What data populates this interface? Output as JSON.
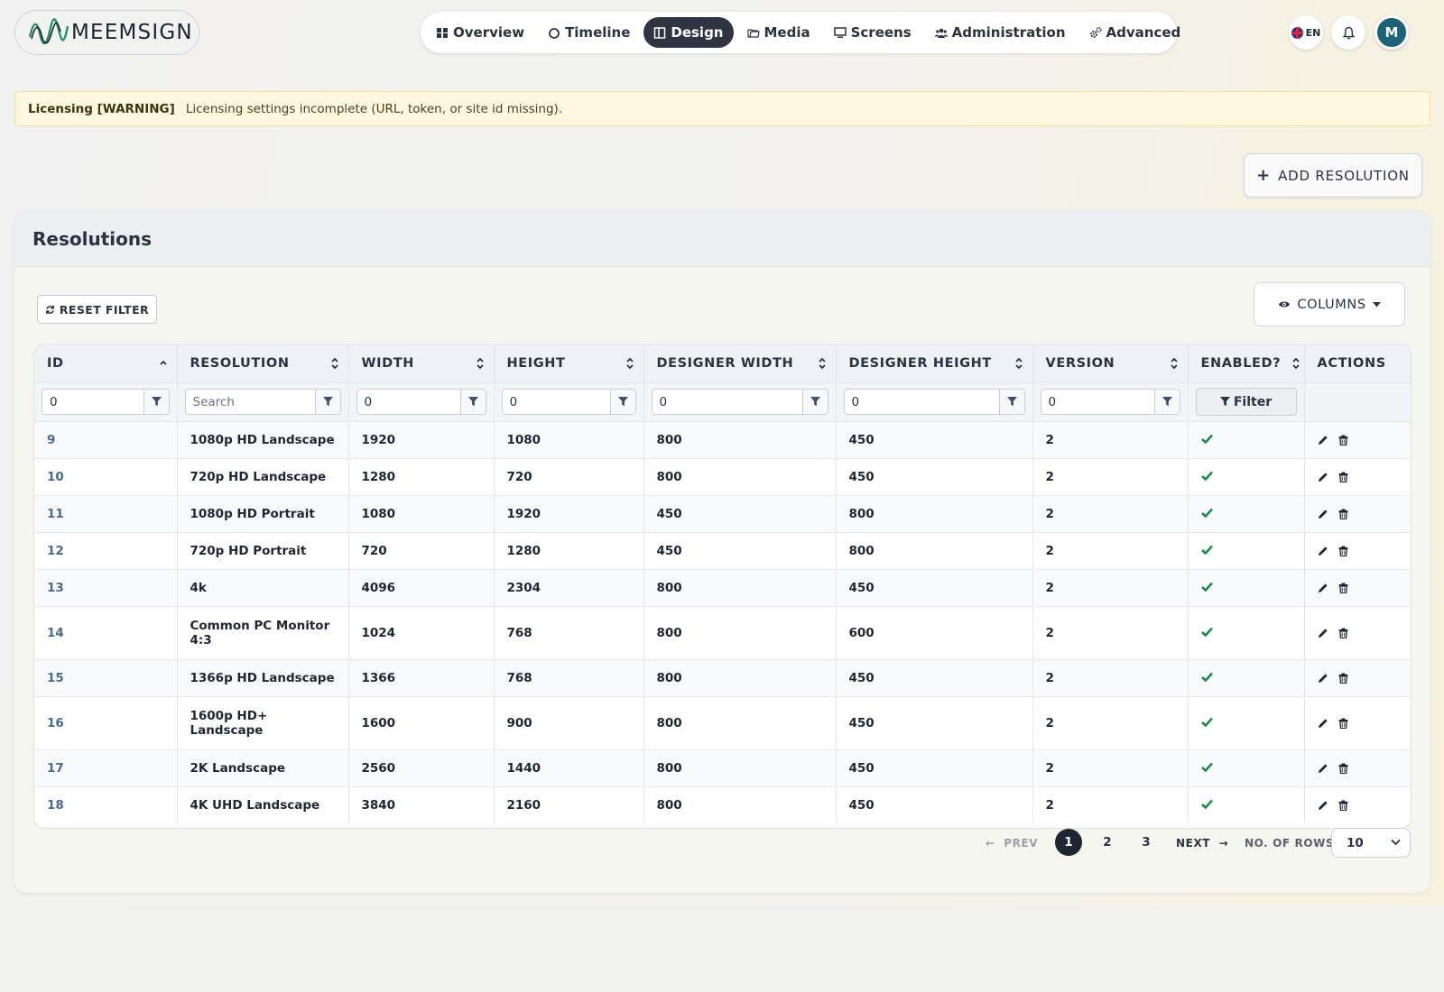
{
  "brand": {
    "name": "MEEMSIGN"
  },
  "nav": {
    "items": [
      {
        "label": "Overview",
        "icon": "grid-icon"
      },
      {
        "label": "Timeline",
        "icon": "circle-icon"
      },
      {
        "label": "Design",
        "icon": "layout-icon",
        "active": true
      },
      {
        "label": "Media",
        "icon": "folder-icon"
      },
      {
        "label": "Screens",
        "icon": "monitor-icon"
      },
      {
        "label": "Administration",
        "icon": "users-icon"
      },
      {
        "label": "Advanced",
        "icon": "cogs-icon"
      }
    ]
  },
  "header": {
    "lang": "EN",
    "avatar_initial": "M"
  },
  "alert": {
    "title": "Licensing [WARNING]",
    "message": "Licensing settings incomplete (URL, token, or site id missing)."
  },
  "toolbar": {
    "add_label": "ADD RESOLUTION"
  },
  "card": {
    "title": "Resolutions",
    "reset_label": "RESET FILTER",
    "columns_label": "COLUMNS"
  },
  "table": {
    "headers": [
      "ID",
      "RESOLUTION",
      "WIDTH",
      "HEIGHT",
      "DESIGNER WIDTH",
      "DESIGNER HEIGHT",
      "VERSION",
      "ENABLED?",
      "ACTIONS"
    ],
    "filters": {
      "id": "0",
      "resolution_placeholder": "Search",
      "width": "0",
      "height": "0",
      "designer_width": "0",
      "designer_height": "0",
      "version": "0",
      "enabled_label": "Filter"
    },
    "rows": [
      {
        "id": "9",
        "resolution": "1080p HD Landscape",
        "width": "1920",
        "height": "1080",
        "dw": "800",
        "dh": "450",
        "version": "2",
        "enabled": true
      },
      {
        "id": "10",
        "resolution": "720p HD Landscape",
        "width": "1280",
        "height": "720",
        "dw": "800",
        "dh": "450",
        "version": "2",
        "enabled": true
      },
      {
        "id": "11",
        "resolution": "1080p HD Portrait",
        "width": "1080",
        "height": "1920",
        "dw": "450",
        "dh": "800",
        "version": "2",
        "enabled": true
      },
      {
        "id": "12",
        "resolution": "720p HD Portrait",
        "width": "720",
        "height": "1280",
        "dw": "450",
        "dh": "800",
        "version": "2",
        "enabled": true
      },
      {
        "id": "13",
        "resolution": "4k",
        "width": "4096",
        "height": "2304",
        "dw": "800",
        "dh": "450",
        "version": "2",
        "enabled": true
      },
      {
        "id": "14",
        "resolution": "Common PC Monitor 4:3",
        "width": "1024",
        "height": "768",
        "dw": "800",
        "dh": "600",
        "version": "2",
        "enabled": true
      },
      {
        "id": "15",
        "resolution": "1366p HD Landscape",
        "width": "1366",
        "height": "768",
        "dw": "800",
        "dh": "450",
        "version": "2",
        "enabled": true
      },
      {
        "id": "16",
        "resolution": "1600p HD+ Landscape",
        "width": "1600",
        "height": "900",
        "dw": "800",
        "dh": "450",
        "version": "2",
        "enabled": true
      },
      {
        "id": "17",
        "resolution": "2K Landscape",
        "width": "2560",
        "height": "1440",
        "dw": "800",
        "dh": "450",
        "version": "2",
        "enabled": true
      },
      {
        "id": "18",
        "resolution": "4K UHD Landscape",
        "width": "3840",
        "height": "2160",
        "dw": "800",
        "dh": "450",
        "version": "2",
        "enabled": true
      }
    ]
  },
  "pagination": {
    "prev_label": "PREV",
    "next_label": "NEXT",
    "pages": [
      "1",
      "2",
      "3"
    ],
    "current": "1",
    "rows_label": "NO. OF ROWS",
    "rows_value": "10"
  },
  "colors": {
    "accent_dark": "#2e3440",
    "check_green": "#1e8a4c",
    "avatar": "#1d6277",
    "alert_bg": "#fff8e1"
  }
}
